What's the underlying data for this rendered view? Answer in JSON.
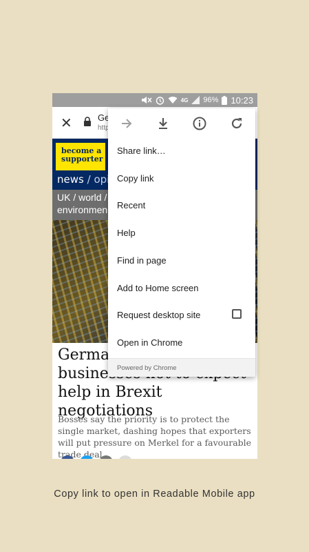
{
  "status_bar": {
    "network": "4G",
    "battery": "96%",
    "time": "10:23"
  },
  "browser_toolbar": {
    "title": "Ge",
    "url": "http"
  },
  "page": {
    "supporter_badge": "become a supporter",
    "nav_primary": [
      "news",
      "opin"
    ],
    "nav_secondary": [
      "UK",
      "world",
      "environmen"
    ],
    "headline": "Germany tells its businesses not to expect help in Brexit negotiations",
    "standfirst": "Bosses say the priority is to protect the single market, dashing hopes that exporters will put pressure on Merkel for a favourable trade deal"
  },
  "menu": {
    "icons": [
      "forward-icon",
      "download-icon",
      "info-icon",
      "refresh-icon"
    ],
    "items": [
      "Share link…",
      "Copy link",
      "Recent",
      "Help",
      "Find in page",
      "Add to Home screen",
      "Request desktop site",
      "Open in Chrome"
    ],
    "request_desktop_checked": false,
    "footer": "Powered by Chrome"
  },
  "caption": "Copy link to open in Readable Mobile app",
  "colors": {
    "background": "#eadfc2",
    "status_bar": "#9e9e9e",
    "guardian_blue": "#052962",
    "supporter_yellow": "#ffe500"
  }
}
